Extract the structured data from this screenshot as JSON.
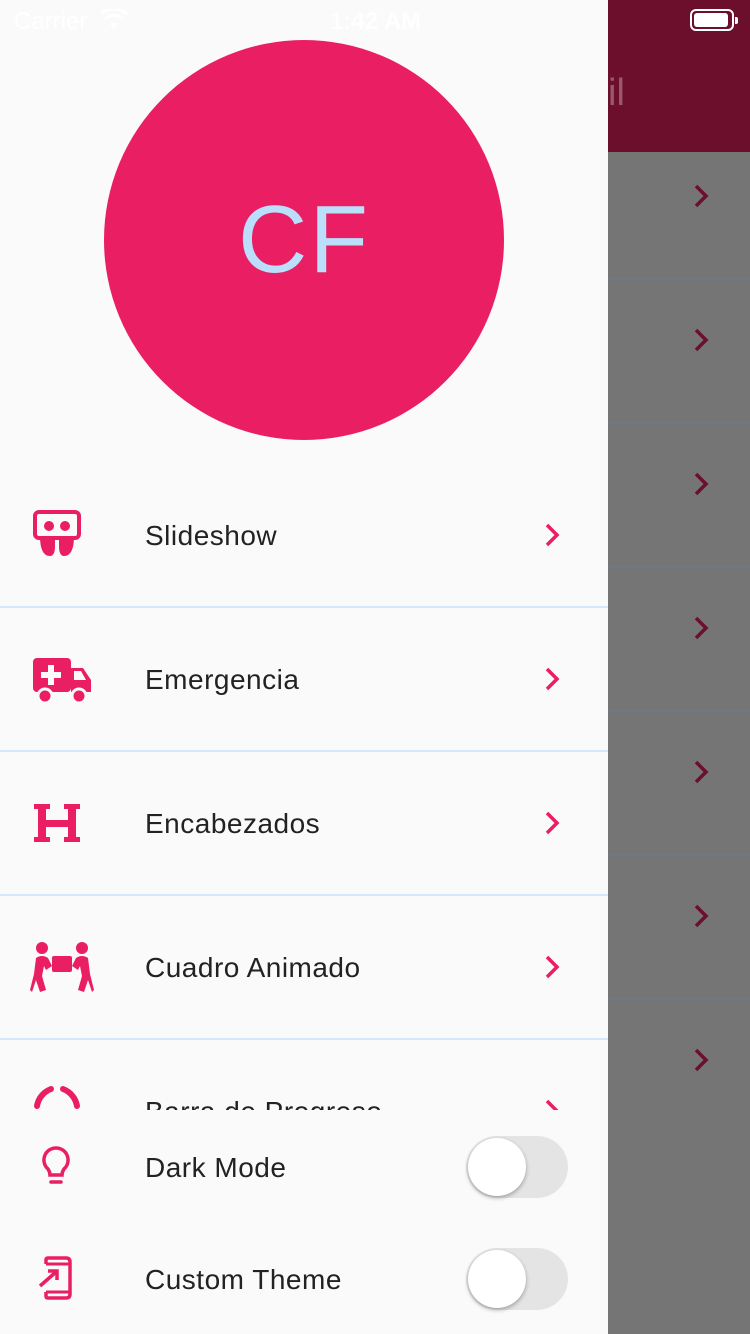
{
  "status_bar": {
    "carrier": "Carrier",
    "time": "1:42 AM"
  },
  "background": {
    "title": "il",
    "rows": 7,
    "appbar_color": "#6b0f2c"
  },
  "drawer": {
    "avatar": {
      "initials": "CF",
      "bg_color": "#e91e63",
      "text_color": "#bbdefb"
    },
    "menu_items": [
      {
        "label": "Slideshow",
        "icon": "slideshare-icon"
      },
      {
        "label": "Emergencia",
        "icon": "ambulance-icon"
      },
      {
        "label": "Encabezados",
        "icon": "heading-icon"
      },
      {
        "label": "Cuadro Animado",
        "icon": "people-carry-icon"
      },
      {
        "label": "Barra de Progreso",
        "icon": "circle-notch-icon"
      }
    ],
    "settings": [
      {
        "label": "Dark Mode",
        "icon": "lightbulb-icon",
        "enabled": false
      },
      {
        "label": "Custom Theme",
        "icon": "add-to-home-screen-icon",
        "enabled": false
      }
    ],
    "accent_color": "#e91e63"
  }
}
